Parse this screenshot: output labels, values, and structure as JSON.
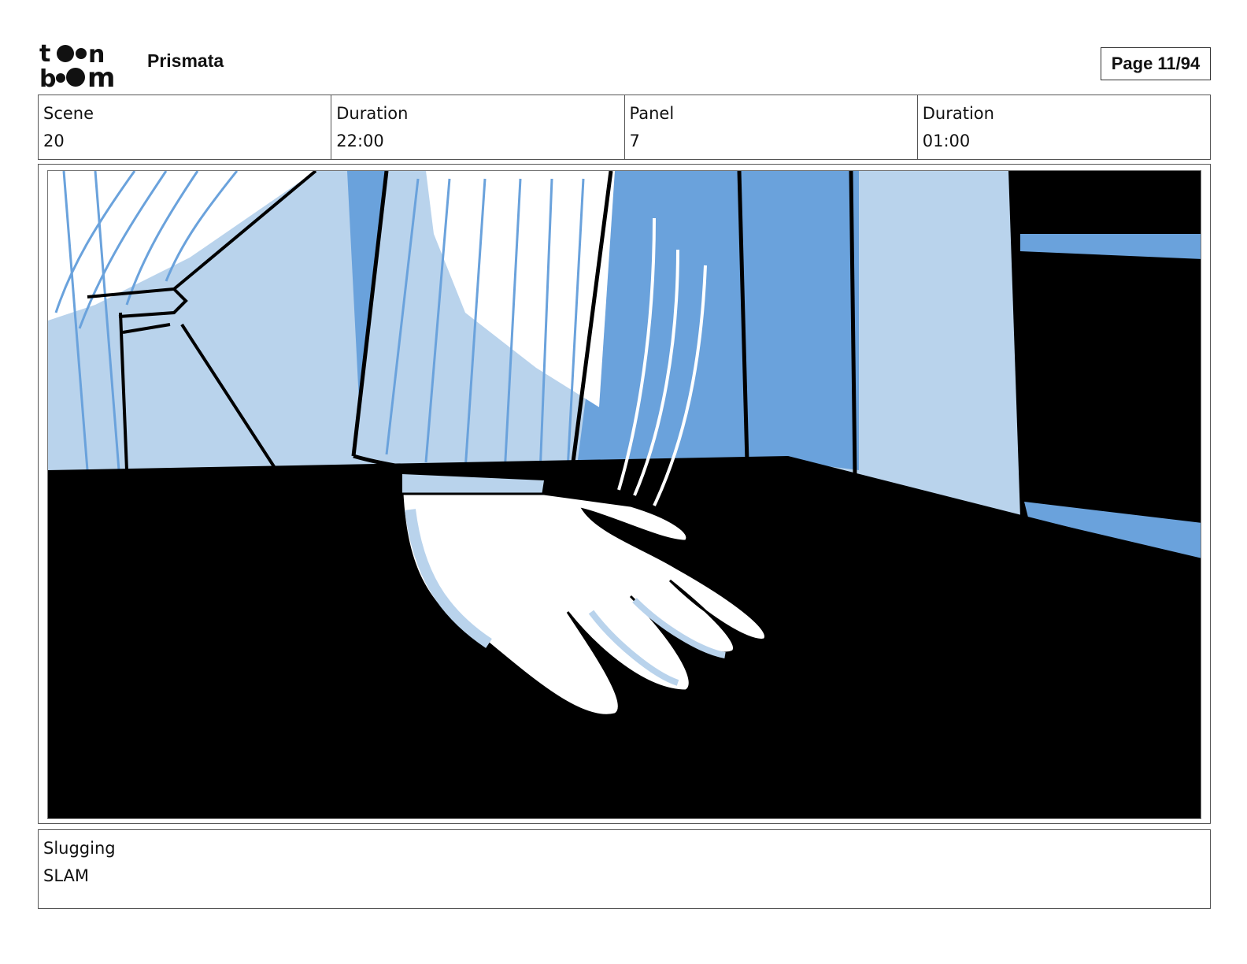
{
  "header": {
    "logo_text": "toon boom",
    "project_title": "Prismata",
    "page_indicator": "Page 11/94"
  },
  "info": {
    "scene_label": "Scene",
    "scene_value": "20",
    "scene_duration_label": "Duration",
    "scene_duration_value": "22:00",
    "panel_label": "Panel",
    "panel_value": "7",
    "panel_duration_label": "Duration",
    "panel_duration_value": "01:00"
  },
  "slugging": {
    "label": "Slugging",
    "value": "SLAM"
  },
  "colors": {
    "light_blue": "#b9d3ec",
    "mid_blue": "#6aa2dc",
    "black": "#000000",
    "white": "#ffffff"
  }
}
